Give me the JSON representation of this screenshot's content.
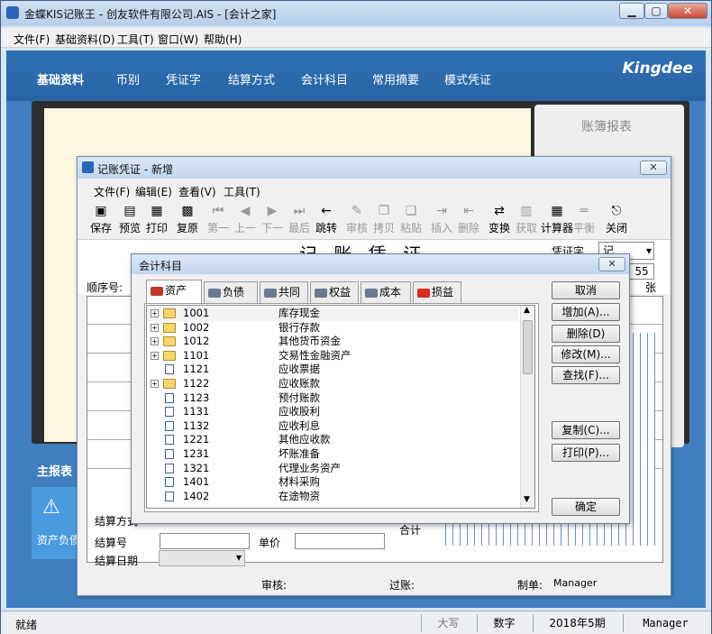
{
  "window": {
    "title": "金蝶KIS记账王 - 创友软件有限公司.AIS - [会计之家]",
    "menu": [
      "文件(F)",
      "基础资料(D)",
      "工具(T)",
      "窗口(W)",
      "帮助(H)"
    ]
  },
  "app": {
    "nav": [
      "基础资料",
      "币别",
      "凭证字",
      "结算方式",
      "会计科目",
      "常用摘要",
      "模式凭证"
    ],
    "brand": "Kingdee",
    "account_book": "账簿报表",
    "main_report": "主报表",
    "warn_label": "资产负债"
  },
  "voucher": {
    "title": "记账凭证 - 新增",
    "menu": [
      "文件(F)",
      "编辑(E)",
      "查看(V)",
      "工具(T)"
    ],
    "toolbar": [
      {
        "label": "保存",
        "icon": "save-icon",
        "glyph": "▣",
        "enabled": true
      },
      {
        "label": "预览",
        "icon": "preview-icon",
        "glyph": "▤",
        "enabled": true
      },
      {
        "label": "打印",
        "icon": "print-icon",
        "glyph": "▦",
        "enabled": true
      },
      {
        "label": "复原",
        "icon": "restore-icon",
        "glyph": "▩",
        "enabled": true
      },
      {
        "label": "第一",
        "icon": "first-icon",
        "glyph": "⏮",
        "enabled": false
      },
      {
        "label": "上一",
        "icon": "prev-icon",
        "glyph": "◀",
        "enabled": false
      },
      {
        "label": "下一",
        "icon": "next-icon",
        "glyph": "▶",
        "enabled": false
      },
      {
        "label": "最后",
        "icon": "last-icon",
        "glyph": "⏭",
        "enabled": false
      },
      {
        "label": "跳转",
        "icon": "jump-icon",
        "glyph": "←",
        "enabled": true
      },
      {
        "label": "审核",
        "icon": "audit-icon",
        "glyph": "✎",
        "enabled": false
      },
      {
        "label": "拷贝",
        "icon": "copy-icon",
        "glyph": "❐",
        "enabled": false
      },
      {
        "label": "粘贴",
        "icon": "paste-icon",
        "glyph": "❏",
        "enabled": false
      },
      {
        "label": "插入",
        "icon": "insert-icon",
        "glyph": "⇥",
        "enabled": false
      },
      {
        "label": "删除",
        "icon": "delete-icon",
        "glyph": "⇤",
        "enabled": false
      },
      {
        "label": "变换",
        "icon": "transform-icon",
        "glyph": "⇄",
        "enabled": true
      },
      {
        "label": "获取",
        "icon": "fetch-icon",
        "glyph": "▥",
        "enabled": false
      },
      {
        "label": "计算器",
        "icon": "calculator-icon",
        "glyph": "▦",
        "enabled": true
      },
      {
        "label": "平衡",
        "icon": "balance-icon",
        "glyph": "═",
        "enabled": false
      },
      {
        "label": "关闭",
        "icon": "exit-icon",
        "glyph": "⎋",
        "enabled": true
      }
    ],
    "heading": "记 账 凭 证",
    "voucher_word_label": "凭证字",
    "voucher_word_value": "记",
    "number_value": "55",
    "zhang": "张",
    "seq_label": "顺序号:",
    "settle_method": "结算方式",
    "settle_no": "结算号",
    "unit_price": "单价",
    "settle_date": "结算日期",
    "total": "合计",
    "audit_label": "审核:",
    "post_label": "过账:",
    "maker_label": "制单:",
    "maker_value": "Manager"
  },
  "dialog": {
    "title": "会计科目",
    "tabs": [
      "资产",
      "负债",
      "共同",
      "权益",
      "成本",
      "损益"
    ],
    "rows": [
      {
        "code": "1001",
        "name": "库存现金",
        "type": "folder",
        "expand": true
      },
      {
        "code": "1002",
        "name": "银行存款",
        "type": "folder",
        "expand": true
      },
      {
        "code": "1012",
        "name": "其他货币资金",
        "type": "folder",
        "expand": true
      },
      {
        "code": "1101",
        "name": "交易性金融资产",
        "type": "folder",
        "expand": true
      },
      {
        "code": "1121",
        "name": "应收票据",
        "type": "doc",
        "expand": false
      },
      {
        "code": "1122",
        "name": "应收账款",
        "type": "folder",
        "expand": true
      },
      {
        "code": "1123",
        "name": "预付账款",
        "type": "doc",
        "expand": false
      },
      {
        "code": "1131",
        "name": "应收股利",
        "type": "doc",
        "expand": false
      },
      {
        "code": "1132",
        "name": "应收利息",
        "type": "doc",
        "expand": false
      },
      {
        "code": "1221",
        "name": "其他应收款",
        "type": "doc",
        "expand": false
      },
      {
        "code": "1231",
        "name": "坏账准备",
        "type": "doc",
        "expand": false
      },
      {
        "code": "1321",
        "name": "代理业务资产",
        "type": "doc",
        "expand": false
      },
      {
        "code": "1401",
        "name": "材料采购",
        "type": "doc",
        "expand": false
      },
      {
        "code": "1402",
        "name": "在途物资",
        "type": "doc",
        "expand": false
      }
    ],
    "buttons": {
      "cancel": "取消",
      "add": "增加(A)...",
      "delete": "删除(D)",
      "modify": "修改(M)...",
      "find": "查找(F)...",
      "copy": "复制(C)...",
      "print": "打印(P)...",
      "ok": "确定"
    }
  },
  "status": {
    "ready": "就绪",
    "caps": "大写",
    "num": "数字",
    "period": "2018年5期",
    "user": "Manager"
  }
}
